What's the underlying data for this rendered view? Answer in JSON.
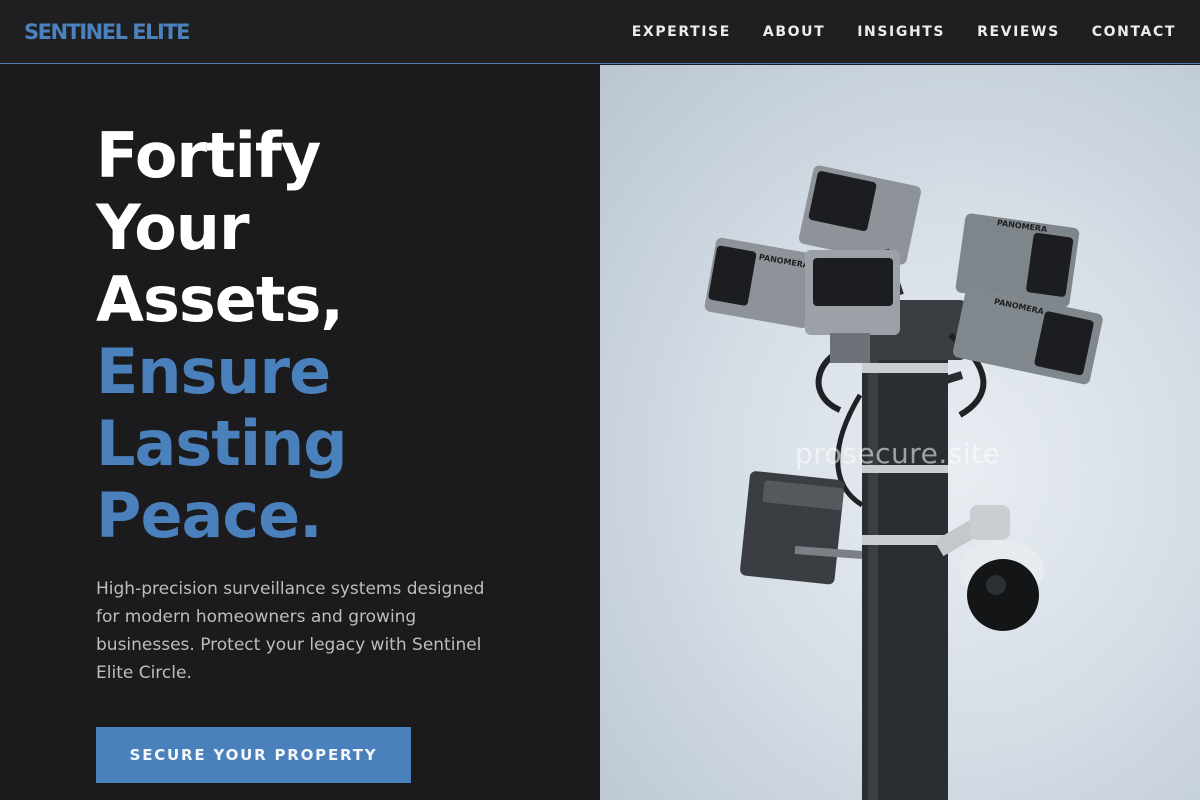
{
  "brand": {
    "name": "SENTINEL ELITE"
  },
  "nav": {
    "items": [
      {
        "label": "EXPERTISE"
      },
      {
        "label": "ABOUT"
      },
      {
        "label": "INSIGHTS"
      },
      {
        "label": "REVIEWS"
      },
      {
        "label": "CONTACT"
      }
    ]
  },
  "hero": {
    "headline_white": [
      "Fortify",
      "Your",
      "Assets,"
    ],
    "headline_blue": [
      "Ensure",
      "Lasting",
      "Peace."
    ],
    "description": "High-precision surveillance systems designed for modern homeowners and growing businesses. Protect your legacy with Sentinel Elite Circle.",
    "cta_label": "SECURE YOUR PROPERTY"
  },
  "image": {
    "camera_brand": "PANOMERA",
    "watermark": "prosecure.site"
  },
  "colors": {
    "accent": "#4a80bb",
    "background": "#1b1b1d",
    "sky": "#d6dee6"
  }
}
